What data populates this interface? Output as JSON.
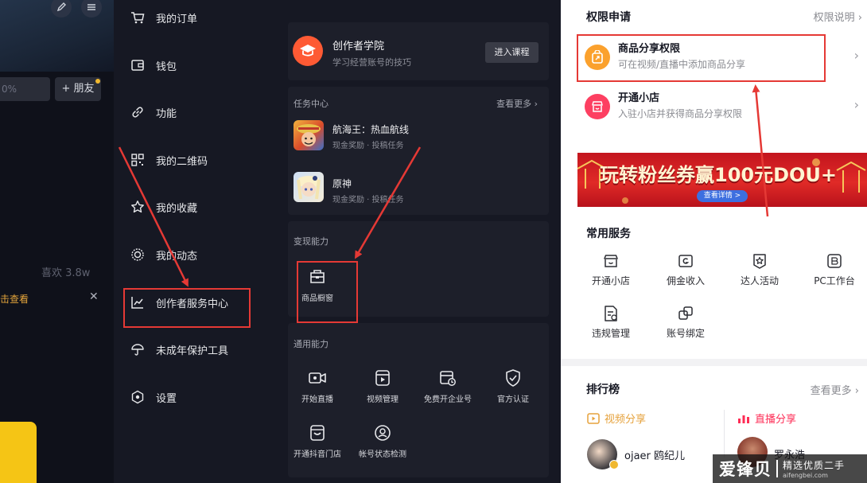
{
  "colors": {
    "accent_red": "#e53935",
    "dark_bg": "#161823",
    "card_bg": "#1d1f2a",
    "academy_orange": "#fe5a34",
    "share_orange": "#fba12d",
    "shop_pink": "#fd3f61",
    "list_red": "#fe2c55",
    "list_gold": "#e6a23c"
  },
  "profile_fragment": {
    "percent_text": "0%",
    "add_friend": "+ 朋友",
    "likes": "喜欢 3.8w",
    "click_watch": "击查看",
    "close_icon": "close-icon"
  },
  "menu": {
    "items": [
      {
        "label": "我的订单",
        "icon": "cart-icon"
      },
      {
        "label": "钱包",
        "icon": "wallet-icon"
      },
      {
        "label": "功能",
        "icon": "link-icon"
      },
      {
        "label": "我的二维码",
        "icon": "qrcode-icon"
      },
      {
        "label": "我的收藏",
        "icon": "star-icon"
      },
      {
        "label": "我的动态",
        "icon": "activity-icon"
      },
      {
        "label": "创作者服务中心",
        "icon": "chart-icon"
      },
      {
        "label": "未成年保护工具",
        "icon": "umbrella-icon"
      },
      {
        "label": "设置",
        "icon": "settings-icon"
      }
    ]
  },
  "creator": {
    "academy": {
      "title": "创作者学院",
      "subtitle": "学习经营账号的技巧",
      "button": "进入课程",
      "icon": "graduation-cap-icon"
    },
    "tasks": {
      "title": "任务中心",
      "more": "查看更多",
      "items": [
        {
          "name": "航海王：热血航线",
          "sub": "现金奖励 · 投稿任务"
        },
        {
          "name": "原神",
          "sub": "现金奖励 · 投稿任务"
        }
      ]
    },
    "monetize": {
      "title": "变现能力",
      "items": [
        {
          "label": "商品橱窗",
          "icon": "storefront-icon"
        }
      ]
    },
    "general": {
      "title": "通用能力",
      "items": [
        {
          "label": "开始直播",
          "icon": "live-camera-icon"
        },
        {
          "label": "视频管理",
          "icon": "video-manage-icon"
        },
        {
          "label": "免费开企业号",
          "icon": "enterprise-icon"
        },
        {
          "label": "官方认证",
          "icon": "shield-check-icon"
        },
        {
          "label": "开通抖音门店",
          "icon": "store-icon"
        },
        {
          "label": "帐号状态检测",
          "icon": "account-check-icon"
        }
      ]
    }
  },
  "permissions": {
    "title": "权限申请",
    "explain": "权限说明",
    "items": [
      {
        "title": "商品分享权限",
        "sub": "可在视频/直播中添加商品分享",
        "icon": "share-bag-icon"
      },
      {
        "title": "开通小店",
        "sub": "入驻小店并获得商品分享权限",
        "icon": "shop-icon"
      }
    ],
    "banner": {
      "headline": "玩转粉丝券赢100元DOU+",
      "button": "查看详情 >"
    }
  },
  "services": {
    "title": "常用服务",
    "items": [
      {
        "label": "开通小店",
        "icon": "shop-outline-icon"
      },
      {
        "label": "佣金收入",
        "icon": "commission-icon"
      },
      {
        "label": "达人活动",
        "icon": "badge-star-icon"
      },
      {
        "label": "PC工作台",
        "icon": "pc-workbench-icon"
      },
      {
        "label": "违规管理",
        "icon": "document-warning-icon"
      },
      {
        "label": "账号绑定",
        "icon": "link-accounts-icon"
      }
    ]
  },
  "ranking": {
    "title": "排行榜",
    "more": "查看更多",
    "tabs": [
      {
        "label": "视频分享",
        "icon": "video-share-icon"
      },
      {
        "label": "直播分享",
        "icon": "live-bars-icon"
      }
    ],
    "entries": [
      {
        "name": "ojaer 鸥纪儿"
      },
      {
        "name": "罗永浩"
      }
    ]
  },
  "watermark": {
    "main": "爱锋贝",
    "tagline": "精选优质二手",
    "url": "aifengbei.com"
  }
}
